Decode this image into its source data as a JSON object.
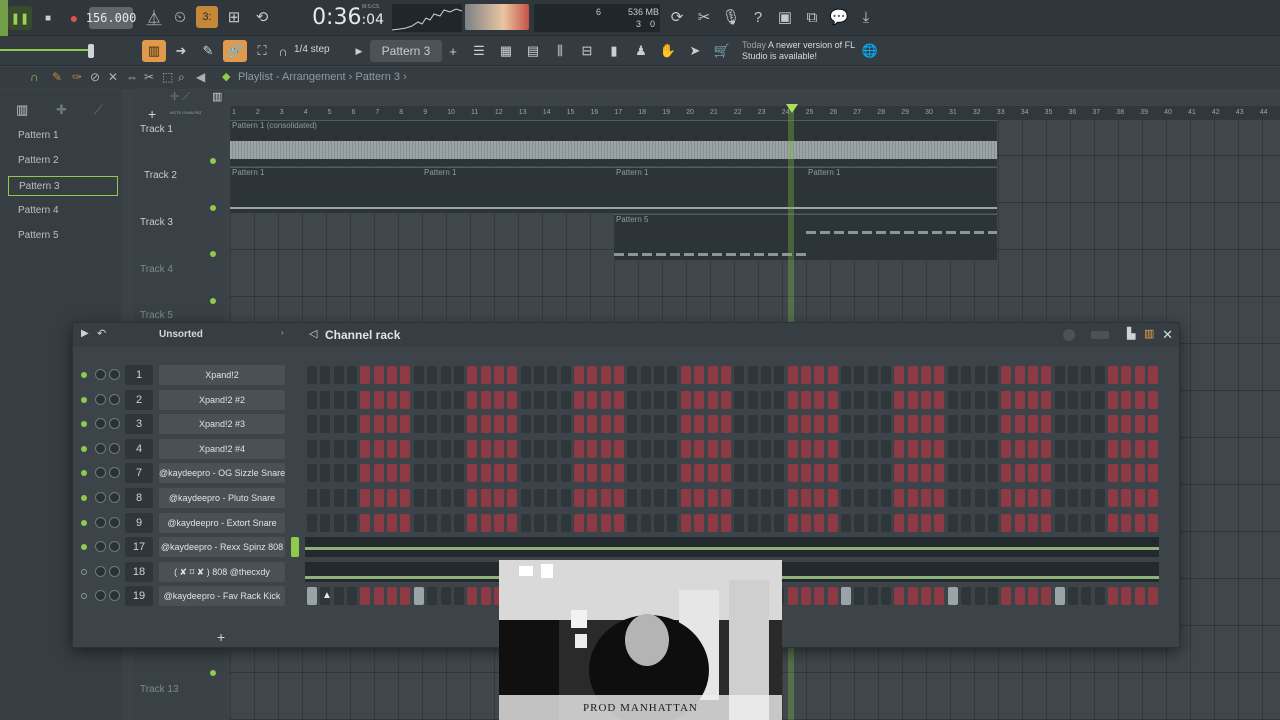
{
  "toolbar": {
    "tempo": "156.000",
    "time_main": "0:36",
    "time_sub": ":04",
    "time_mode_label": "M:S:CS",
    "cpu_voices": "6",
    "cpu_mem": "536 MB",
    "cpu_polyphony": "3",
    "cpu_zero": "0"
  },
  "toolbar2": {
    "snap": "1/4 step",
    "pattern_selected": "Pattern 3",
    "news_date": "Today",
    "news_text": "A newer version of FL Studio is available!"
  },
  "playlist": {
    "breadcrumb": "Playlist - Arrangement › Pattern 3 ›",
    "patterns": [
      "Pattern 1",
      "Pattern 2",
      "Pattern 3",
      "Pattern 4",
      "Pattern 5"
    ],
    "selected_pattern_index": 2,
    "tracks": [
      "Track 1",
      "Track 2",
      "Track 3",
      "Track 4",
      "Track 5",
      "Track 13"
    ],
    "ruler": [
      "1",
      "2",
      "3",
      "4",
      "5",
      "6",
      "7",
      "8",
      "9",
      "10",
      "11",
      "12",
      "13",
      "14",
      "15",
      "16",
      "17",
      "18",
      "19",
      "20",
      "21",
      "22",
      "23",
      "24",
      "25",
      "26",
      "27",
      "28",
      "29",
      "30",
      "31",
      "32",
      "33",
      "34",
      "35",
      "36",
      "37",
      "38",
      "39",
      "40",
      "41",
      "42",
      "43",
      "44"
    ],
    "clip_consolidated": "Pattern 1 (consolidated)",
    "clip_pattern1": "Pattern 1",
    "clip_pattern5": "Pattern 5"
  },
  "channel_rack": {
    "filter": "Unsorted",
    "title": "Channel rack",
    "channels": [
      {
        "num": "1",
        "name": "Xpand!2",
        "on": true
      },
      {
        "num": "2",
        "name": "Xpand!2 #2",
        "on": true
      },
      {
        "num": "3",
        "name": "Xpand!2 #3",
        "on": true
      },
      {
        "num": "4",
        "name": "Xpand!2 #4",
        "on": true
      },
      {
        "num": "7",
        "name": "@kaydeepro - OG Sizzle Snare",
        "on": true
      },
      {
        "num": "8",
        "name": "@kaydeepro - Pluto Snare",
        "on": true
      },
      {
        "num": "9",
        "name": "@kaydeepro - Extort Snare",
        "on": true
      },
      {
        "num": "17",
        "name": "@kaydeepro - Rexx Spinz 808",
        "on": true
      },
      {
        "num": "18",
        "name": "( ✘ ⌑ ✘ )  808 @thecxdy",
        "on": false
      },
      {
        "num": "19",
        "name": "@kaydeepro - Fav Rack Kick",
        "on": false
      }
    ]
  },
  "webcam": {
    "caption": "PROD MANHATTAN"
  },
  "colors": {
    "accent_green": "#8fcb4b",
    "step_on": "#8e3a44",
    "step_off": "#2f363a",
    "orange": "#f0a048"
  }
}
